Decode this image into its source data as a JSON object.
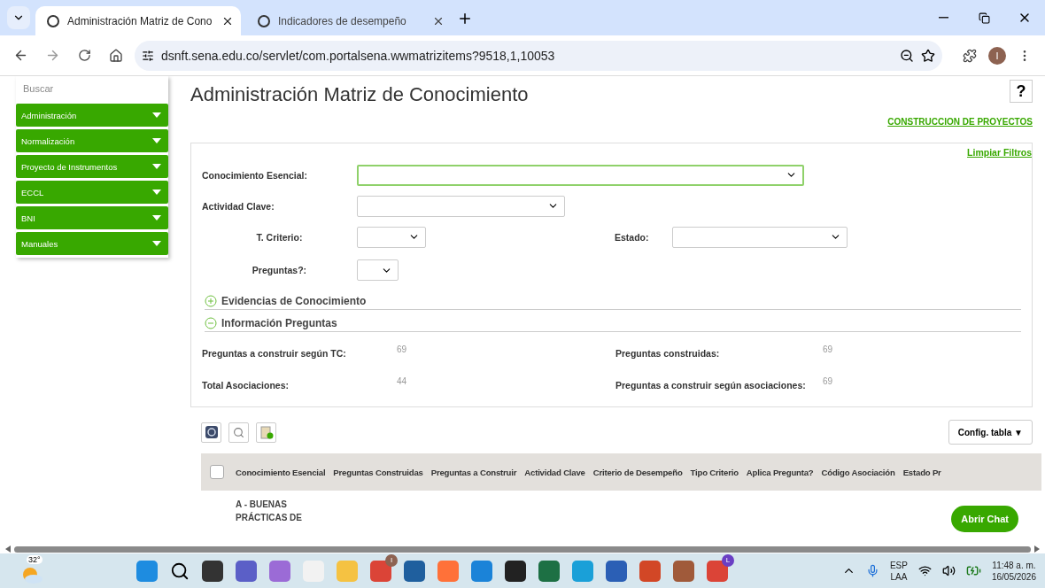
{
  "browser": {
    "tabs": [
      {
        "title": "Administración Matriz de Cono",
        "selected": true
      },
      {
        "title": "Indicadores de desempeño",
        "selected": false
      }
    ],
    "url": "dsnft.sena.edu.co/servlet/com.portalsena.wwmatrizitems?9518,1,10053",
    "profile_initial": "I"
  },
  "sidebar": {
    "search_placeholder": "Buscar",
    "items": [
      {
        "label": "Administración"
      },
      {
        "label": "Normalización"
      },
      {
        "label": "Proyecto de Instrumentos"
      },
      {
        "label": "ECCL"
      },
      {
        "label": "BNI"
      },
      {
        "label": "Manuales"
      }
    ]
  },
  "page": {
    "title": "Administración Matriz de Conocimiento",
    "help": "?",
    "project_link": "CONSTRUCCION DE PROYECTOS"
  },
  "filters": {
    "clear": "Limpiar Filtros",
    "fields": [
      {
        "label": "Conocimiento Esencial:",
        "focused": true
      },
      {
        "label": "Actividad Clave:",
        "focused": false
      },
      {
        "label": "T. Criterio:",
        "focused": false
      },
      {
        "label": "Estado:",
        "focused": false
      },
      {
        "label": "Preguntas?:",
        "focused": false
      }
    ]
  },
  "sections": [
    {
      "title": "Evidencias de Conocimiento",
      "expanded": false
    },
    {
      "title": "Información Preguntas",
      "expanded": true
    }
  ],
  "stats": [
    {
      "label": "Preguntas a construir según TC:",
      "value": "69"
    },
    {
      "label": "Preguntas construidas:",
      "value": "69"
    },
    {
      "label": "Total Asociaciones:",
      "value": "44"
    },
    {
      "label": "Preguntas a construir según asociaciones:",
      "value": "69"
    }
  ],
  "table": {
    "config_button": "Config. tabla ▼",
    "select_all_checked": false,
    "columns": [
      "Conocimiento Esencial",
      "Preguntas Construidas",
      "Preguntas a Construir",
      "Actividad Clave",
      "Criterio de Desempeño",
      "Tipo Criterio",
      "Aplica Pregunta?",
      "Código Asociación",
      "Estado Pr"
    ],
    "rows": [
      {
        "conocimiento": "A - BUENAS PRÁCTICAS DE"
      }
    ]
  },
  "chat_button": "Abrir Chat",
  "taskbar": {
    "weather": "32°",
    "chrome_badge": "I",
    "chrome_badge_2": "L",
    "language": "ESP",
    "layout": "LAA",
    "time": "11:48 a. m.",
    "date": "16/05/2026"
  }
}
